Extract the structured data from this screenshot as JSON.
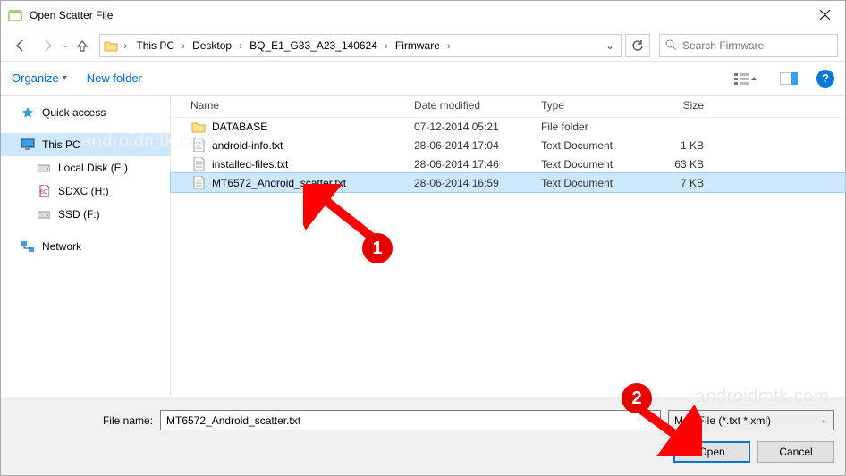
{
  "titlebar": {
    "title": "Open Scatter File"
  },
  "breadcrumb": {
    "items": [
      "This PC",
      "Desktop",
      "BQ_E1_G33_A23_140624",
      "Firmware"
    ]
  },
  "search": {
    "placeholder": "Search Firmware"
  },
  "toolbar": {
    "organize": "Organize",
    "newfolder": "New folder"
  },
  "sidebar": {
    "quick": "Quick access",
    "thispc": "This PC",
    "local": "Local Disk (E:)",
    "sdxc": "SDXC (H:)",
    "ssd": "SSD (F:)",
    "network": "Network"
  },
  "columns": {
    "name": "Name",
    "date": "Date modified",
    "type": "Type",
    "size": "Size"
  },
  "rows": [
    {
      "name": "DATABASE",
      "date": "07-12-2014 05:21",
      "type": "File folder",
      "size": "",
      "kind": "folder"
    },
    {
      "name": "android-info.txt",
      "date": "28-06-2014 17:04",
      "type": "Text Document",
      "size": "1 KB",
      "kind": "txt"
    },
    {
      "name": "installed-files.txt",
      "date": "28-06-2014 17:46",
      "type": "Text Document",
      "size": "63 KB",
      "kind": "txt"
    },
    {
      "name": "MT6572_Android_scatter.txt",
      "date": "28-06-2014 16:59",
      "type": "Text Document",
      "size": "7 KB",
      "kind": "txt"
    }
  ],
  "bottom": {
    "label": "File name:",
    "value": "MT6572_Android_scatter.txt",
    "filter": "Map File (*.txt *.xml)",
    "open": "Open",
    "cancel": "Cancel"
  },
  "annotations": {
    "n1": "1",
    "n2": "2"
  },
  "watermark": "androidmtk.com"
}
